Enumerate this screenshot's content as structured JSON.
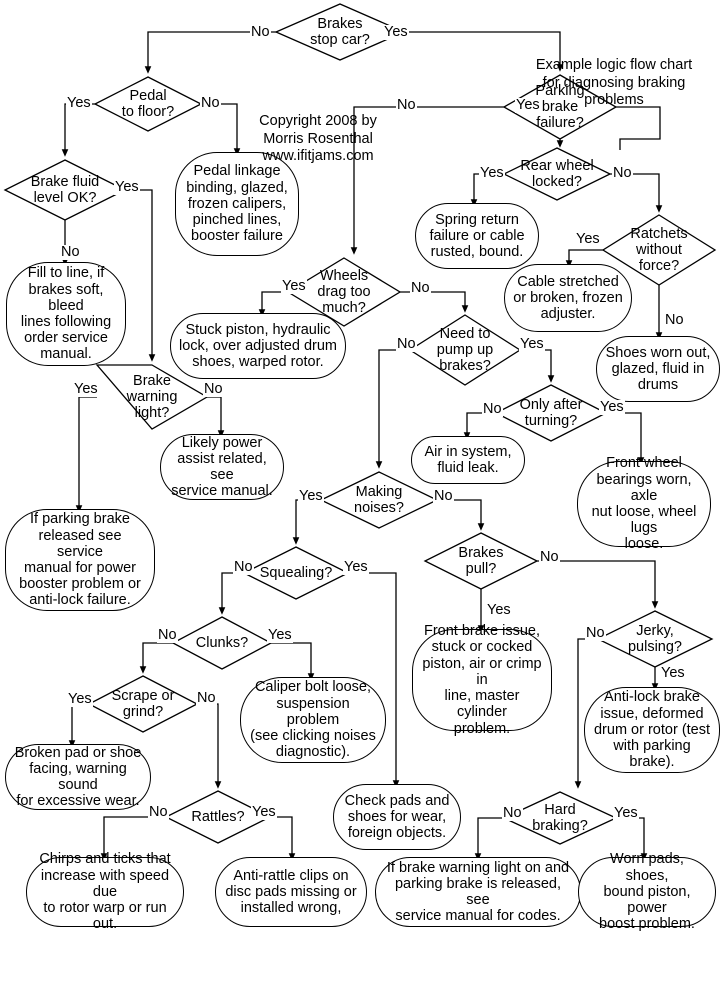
{
  "title": "Example logic flow chart for diagnosing braking problems",
  "annotations": {
    "heading": "Example logic flow chart\nfor diagnosing braking\nproblems",
    "copyright": "Copyright 2008 by\nMorris Rosenthal\nwww.ifitjams.com"
  },
  "edge_labels": {
    "yes": "Yes",
    "no": "No"
  },
  "nodes": {
    "brakes_stop_car": "Brakes\nstop car?",
    "pedal_to_floor": "Pedal\nto floor?",
    "parking_brake_failure": "Parking\nbrake\nfailure?",
    "brake_fluid_level": "Brake fluid\nlevel OK?",
    "rear_wheel_locked": "Rear wheel\nlocked?",
    "ratchets_without_force": "Ratchets\nwithout\nforce?",
    "wheels_drag": "Wheels\ndrag too\nmuch?",
    "need_to_pump": "Need to\npump up\nbrakes?",
    "brake_warning_light": "Brake\nwarning\nlight?",
    "only_after_turning": "Only after\nturning?",
    "making_noises": "Making\nnoises?",
    "brakes_pull": "Brakes\npull?",
    "squealing": "Squealing?",
    "jerky_pulsing": "Jerky,\npulsing?",
    "clunks": "Clunks?",
    "scrape_or_grind": "Scrape or\ngrind?",
    "rattles": "Rattles?",
    "hard_braking": "Hard\nbraking?",
    "pedal_linkage": "Pedal linkage\nbinding, glazed,\nfrozen calipers,\npinched lines,\nbooster failure",
    "fill_to_line": "Fill to line, if\nbrakes soft, bleed\nlines following\norder service\nmanual.",
    "spring_return": "Spring return\nfailure or cable\nrusted, bound.",
    "cable_stretched": "Cable stretched\nor broken, frozen\nadjuster.",
    "shoes_worn_out": "Shoes worn out,\nglazed, fluid in\ndrums",
    "stuck_piston": "Stuck piston, hydraulic\nlock, over adjusted drum\nshoes, warped rotor.",
    "air_in_system": "Air in system,\nfluid leak.",
    "front_wheel_bearings": "Front wheel\nbearings worn, axle\nnut loose, wheel lugs\nloose.",
    "likely_power_assist": "Likely power\nassist related, see\nservice manual.",
    "if_parking_brake": "If parking brake\nreleased see service\nmanual for power\nbooster problem or\nanti-lock failure.",
    "front_brake_issue": "Front brake issue,\nstuck or cocked\npiston, air or crimp in\nline, master cylinder\nproblem.",
    "anti_lock_brake": "Anti-lock brake\nissue, deformed\ndrum or rotor (test\nwith parking brake).",
    "caliper_bolt": "Caliper bolt loose,\nsuspension problem\n(see clicking noises\ndiagnostic).",
    "broken_pad": "Broken pad or shoe\nfacing, warning sound\nfor excessive wear.",
    "check_pads": "Check pads and\nshoes for wear,\nforeign objects.",
    "chirps_and_ticks": "Chirps and ticks that\nincrease with speed due\nto rotor warp or run out.",
    "anti_rattle_clips": "Anti-rattle clips on\ndisc pads missing or\ninstalled wrong,",
    "if_brake_warning": "If brake warning light on and\nparking brake is released, see\nservice manual for codes.",
    "worn_pads": "Worn pads, shoes,\nbound piston, power\nboost problem."
  },
  "colors": {
    "stroke": "#000000",
    "background": "#ffffff",
    "text": "#000000"
  }
}
